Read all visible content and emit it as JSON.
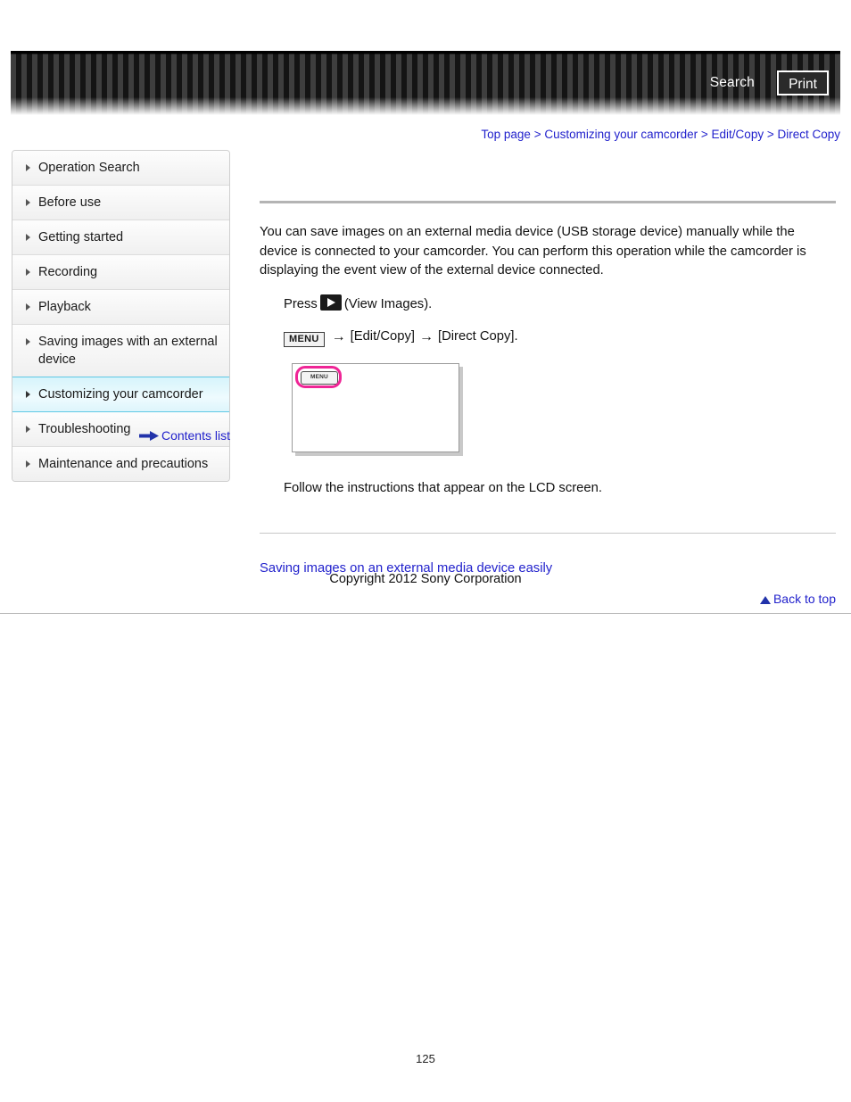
{
  "header": {
    "search_label": "Search",
    "print_label": "Print"
  },
  "breadcrumb": {
    "items": [
      {
        "label": "Top page"
      },
      {
        "label": "Customizing your camcorder"
      },
      {
        "label": "Edit/Copy"
      },
      {
        "label": "Direct Copy"
      }
    ],
    "separator": ">",
    "link_color": "#2222cc"
  },
  "sidebar": {
    "items": [
      {
        "label": "Operation Search",
        "active": false
      },
      {
        "label": "Before use",
        "active": false
      },
      {
        "label": "Getting started",
        "active": false
      },
      {
        "label": "Recording",
        "active": false
      },
      {
        "label": "Playback",
        "active": false
      },
      {
        "label": "Saving images with an external device",
        "active": false
      },
      {
        "label": "Customizing your camcorder",
        "active": true
      },
      {
        "label": "Troubleshooting",
        "active": false
      },
      {
        "label": "Maintenance and precautions",
        "active": false
      }
    ],
    "contents_list_label": "Contents list",
    "active_color": "#5ec8e4"
  },
  "main": {
    "intro_paragraph": "You can save images on an external media device (USB storage device) manually while the device is connected to your camcorder. You can perform this operation while the camcorder is displaying the event view of the external device connected.",
    "step_press_prefix": "Press",
    "step_press_suffix": "(View Images).",
    "view_images_icon_label": "view-images",
    "menu_button_label": "MENU",
    "menu_path_first": "[Edit/Copy]",
    "menu_path_second": "[Direct Copy].",
    "arrow_glyph": "→",
    "lcd_menu_label": "MENU",
    "highlight_color": "#ef2596",
    "follow_text": "Follow the instructions that appear on the LCD screen.",
    "related_link": "Saving images on an external media device easily",
    "back_to_top_label": "Back to top",
    "copyright": "Copyright 2012 Sony Corporation"
  },
  "footer": {
    "page_number": "125"
  }
}
